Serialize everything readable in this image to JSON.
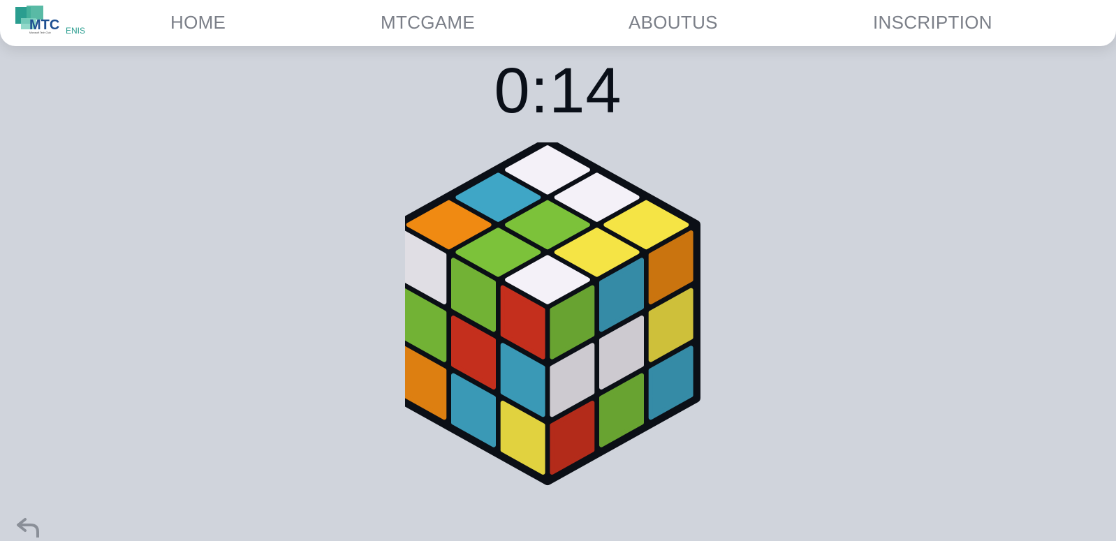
{
  "navbar": {
    "logo_text": "MTC",
    "logo_subtext": "ENIS",
    "logo_tagline": "Microsoft Tech Club",
    "links": [
      {
        "label": "HOME"
      },
      {
        "label": "MTCGAME"
      },
      {
        "label": "ABOUTUS"
      },
      {
        "label": "INSCRIPTION"
      }
    ]
  },
  "game": {
    "timer": "0:14"
  },
  "cube": {
    "top": [
      [
        "orange",
        "blue",
        "white"
      ],
      [
        "green",
        "green",
        "white"
      ],
      [
        "white",
        "yellow",
        "yellow"
      ]
    ],
    "left": [
      [
        "white",
        "green",
        "red"
      ],
      [
        "green",
        "red",
        "blue"
      ],
      [
        "orange",
        "blue",
        "yellow"
      ]
    ],
    "right": [
      [
        "green",
        "blue",
        "orange"
      ],
      [
        "white",
        "white",
        "yellow"
      ],
      [
        "red",
        "green",
        "blue"
      ]
    ]
  },
  "colors": {
    "background": "#d0d4dc",
    "cube_body": "#0b0f16",
    "white": "#f4f1f8",
    "orange": "#f08a12",
    "blue": "#3fa6c6",
    "green": "#7cc23a",
    "yellow": "#f5e445",
    "red": "#d5331f"
  },
  "icons": {
    "back": "undo-arrow-icon"
  }
}
